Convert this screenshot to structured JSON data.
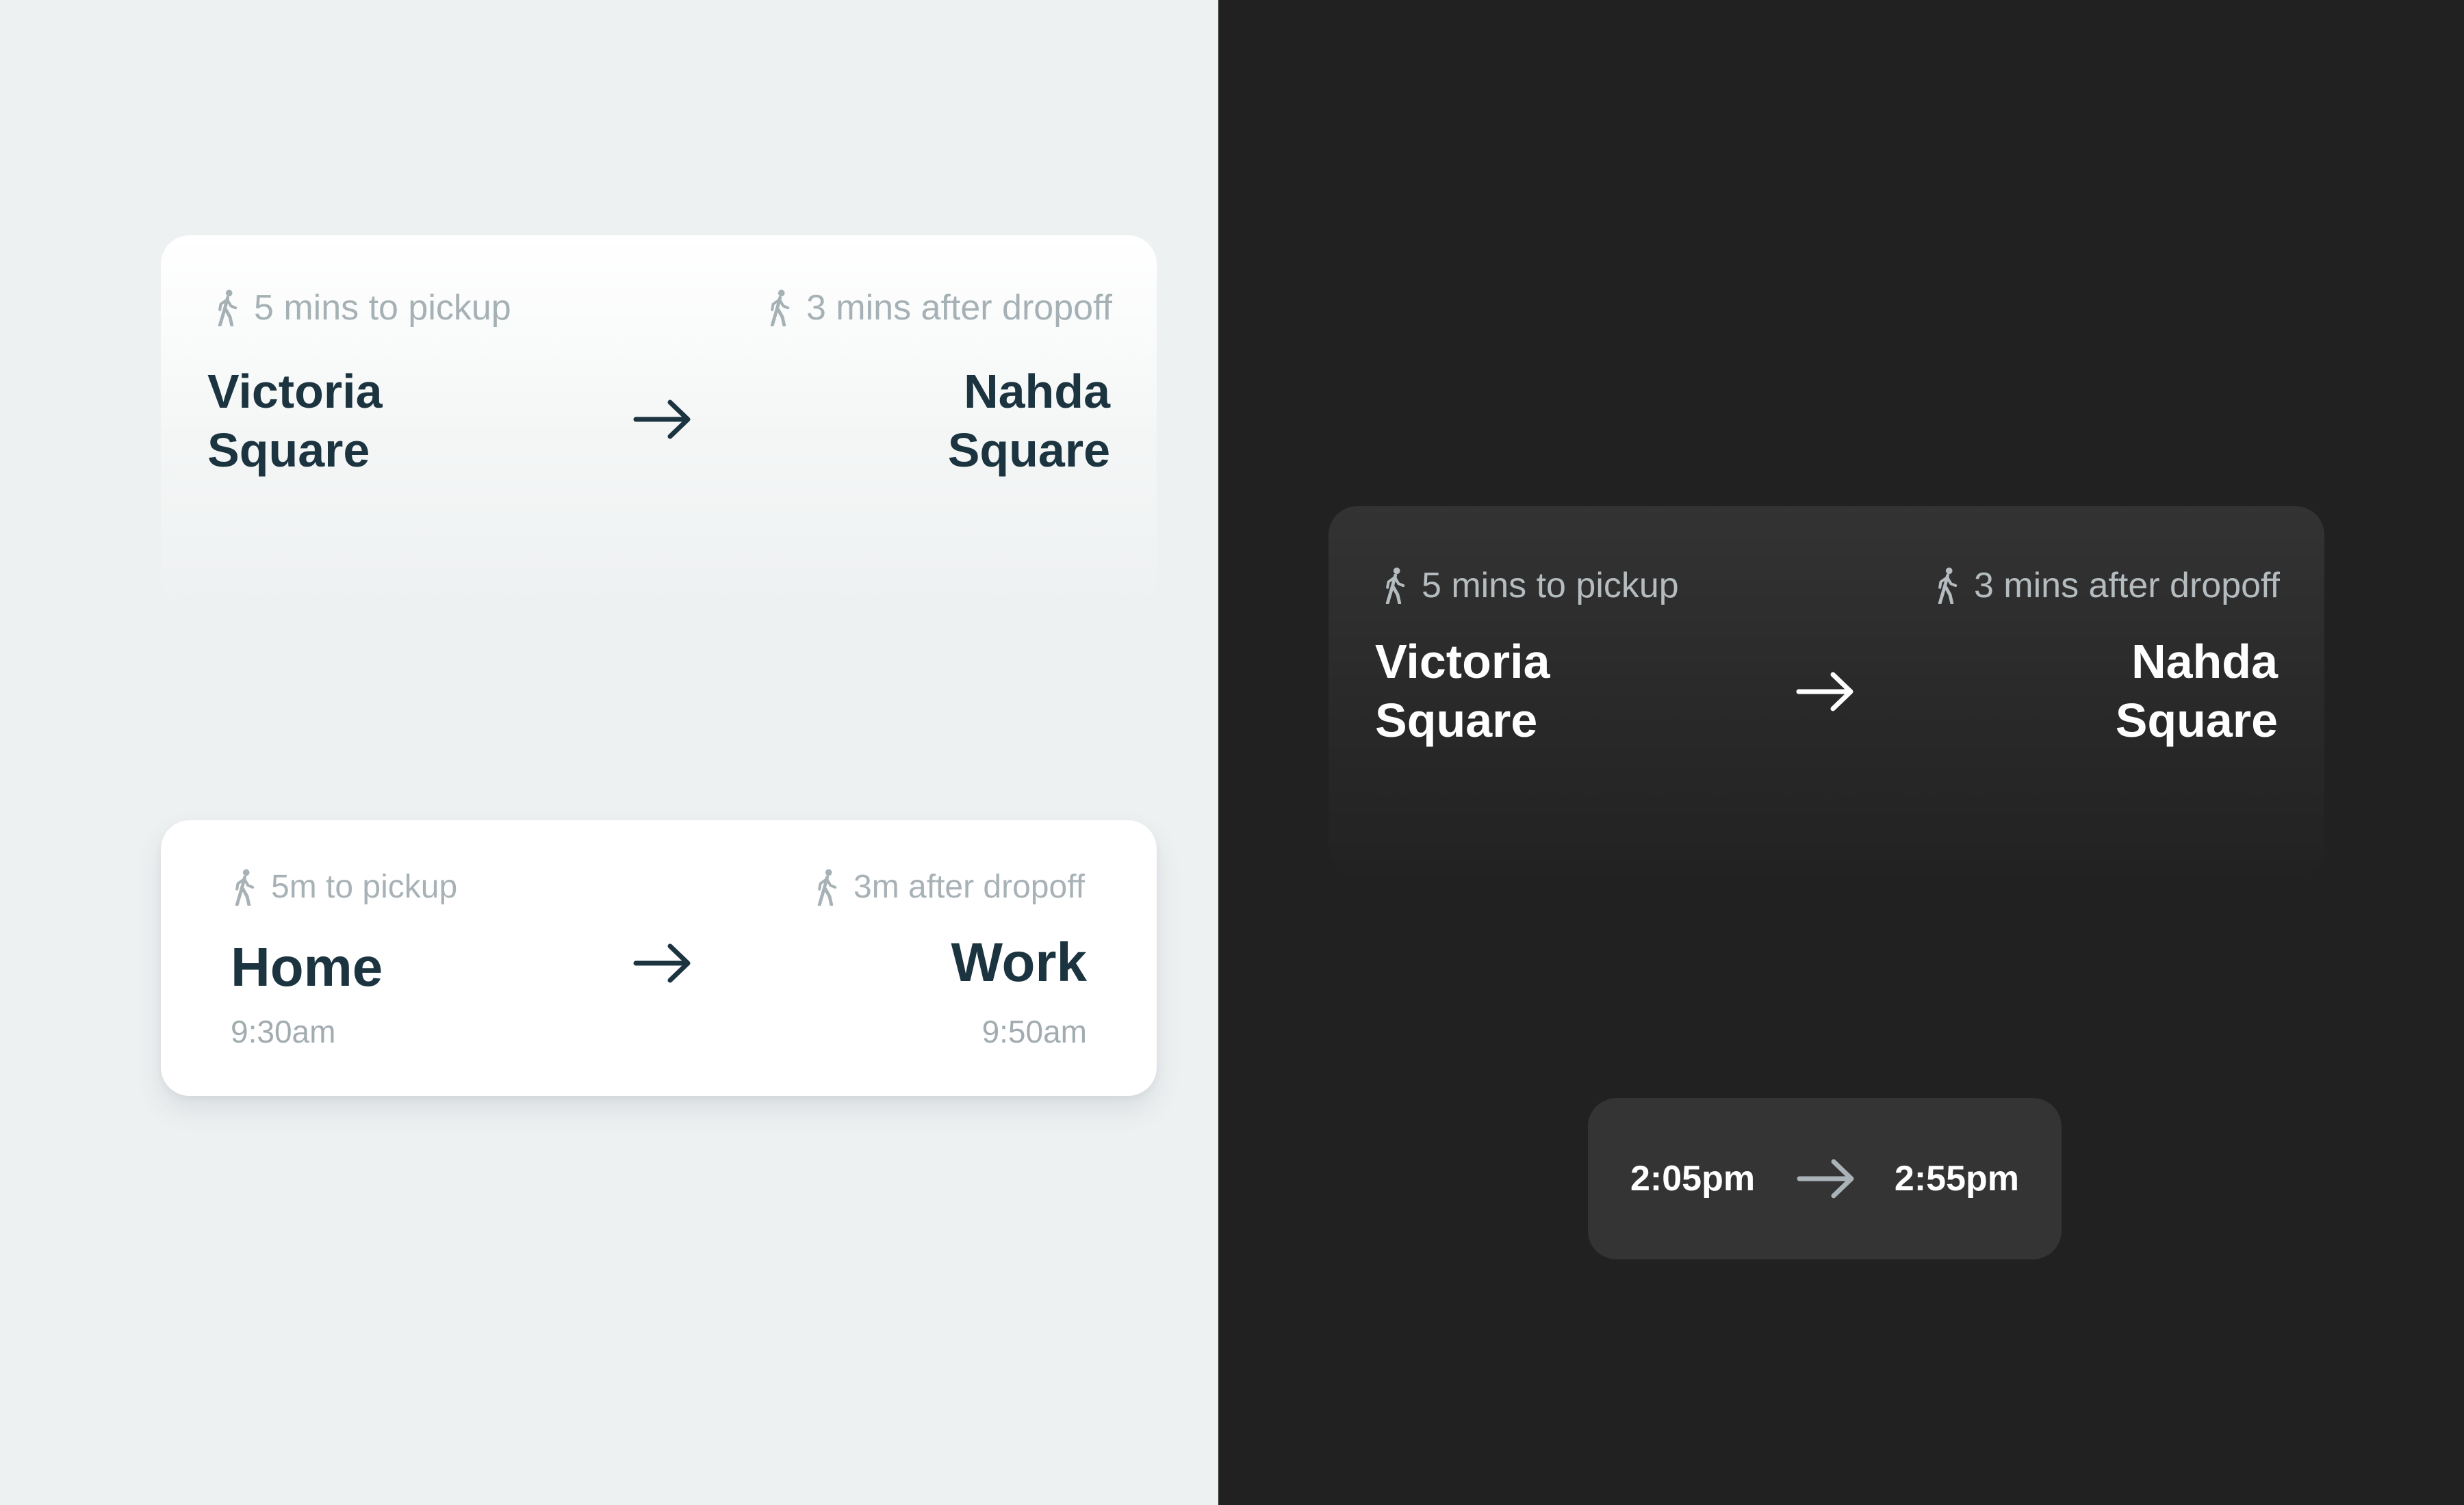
{
  "colors": {
    "light_background": "#eef1f2",
    "dark_background": "#212121",
    "text_primary_light": "#1c3440",
    "text_secondary": "#a6b1b5",
    "text_primary_dark": "#ffffff"
  },
  "cards": {
    "light_fade": {
      "pickup_walk": "5 mins to pickup",
      "dropoff_walk": "3 mins after dropoff",
      "origin_line1": "Victoria",
      "origin_line2": "Square",
      "destination_line1": "Nahda",
      "destination_line2": "Square",
      "walk_icon": "walking-person-icon",
      "arrow_icon": "arrow-right-icon"
    },
    "light_elevated": {
      "pickup_walk": "5m to pickup",
      "dropoff_walk": "3m after dropoff",
      "origin": "Home",
      "destination": "Work",
      "origin_time": "9:30am",
      "destination_time": "9:50am",
      "walk_icon": "walking-person-icon",
      "arrow_icon": "arrow-right-icon"
    },
    "dark_fade": {
      "pickup_walk": "5 mins to pickup",
      "dropoff_walk": "3 mins after dropoff",
      "origin_line1": "Victoria",
      "origin_line2": "Square",
      "destination_line1": "Nahda",
      "destination_line2": "Square",
      "walk_icon": "walking-person-icon",
      "arrow_icon": "arrow-right-icon"
    },
    "dark_pill": {
      "start_time": "2:05pm",
      "end_time": "2:55pm",
      "arrow_icon": "arrow-right-icon"
    }
  }
}
